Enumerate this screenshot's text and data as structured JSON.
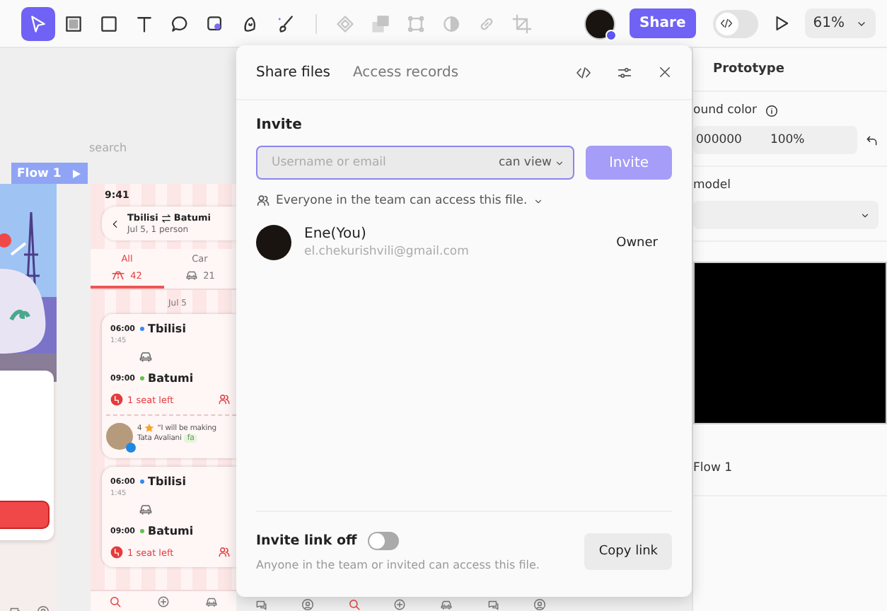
{
  "toolbar": {
    "tools": [
      {
        "selected": true,
        "disabled": false
      },
      {
        "selected": false,
        "disabled": false
      },
      {
        "selected": false,
        "disabled": false
      },
      {
        "selected": false,
        "disabled": false
      },
      {
        "selected": false,
        "disabled": false
      },
      {
        "selected": false,
        "disabled": false
      },
      {
        "selected": false,
        "disabled": false
      },
      {
        "selected": false,
        "disabled": false
      },
      {
        "selected": false,
        "disabled": true
      },
      {
        "selected": false,
        "disabled": true
      },
      {
        "selected": false,
        "disabled": true
      },
      {
        "selected": false,
        "disabled": true
      },
      {
        "selected": false,
        "disabled": true
      },
      {
        "selected": false,
        "disabled": true
      }
    ],
    "share_button": "Share",
    "dev_mode": {
      "on": false
    },
    "zoom": "61%"
  },
  "canvas": {
    "search_label": "search",
    "flow_badge": "Flow 1",
    "phone": {
      "time": "9:41",
      "route": {
        "from": "Tbilisi",
        "to": "Batumi",
        "subtitle": "Jul 5, 1 person"
      },
      "tabs": [
        {
          "label": "All",
          "count": "42",
          "selected": true
        },
        {
          "label": "Car",
          "count": "21",
          "selected": false
        }
      ],
      "date": "Jul 5",
      "trips": [
        {
          "departure": "06:00",
          "from": "Tbilisi",
          "duration": "1:45",
          "arrival": "09:00",
          "to": "Batumi",
          "seats": "1 seat left",
          "review": {
            "rating": "4",
            "quote": "“I will be making",
            "driver": "Tata Avaliani",
            "tag": "fa"
          }
        },
        {
          "departure": "06:00",
          "from": "Tbilisi",
          "duration": "1:45",
          "arrival": "09:00",
          "to": "Batumi",
          "seats": "1 seat left"
        }
      ]
    }
  },
  "share_dialog": {
    "tabs": [
      {
        "label": "Share files",
        "selected": true
      },
      {
        "label": "Access records",
        "selected": false
      }
    ],
    "invite": {
      "heading": "Invite",
      "placeholder": "Username or email",
      "permission": "can view",
      "button": "Invite",
      "button_disabled": true
    },
    "team_access": "Everyone in the team can access this file.",
    "members": [
      {
        "name": "Ene(You)",
        "email": "el.chekurishvili@gmail.com",
        "role": "Owner"
      }
    ],
    "invite_link": {
      "label": "Invite link off",
      "on": false,
      "description": "Anyone in the team or invited can access this file.",
      "copy_button": "Copy link"
    }
  },
  "right_panel": {
    "tab": "Prototype",
    "background_label": "ound color",
    "color_value": "000000",
    "opacity": "100%",
    "model_label": "model",
    "flow": "Flow 1"
  }
}
